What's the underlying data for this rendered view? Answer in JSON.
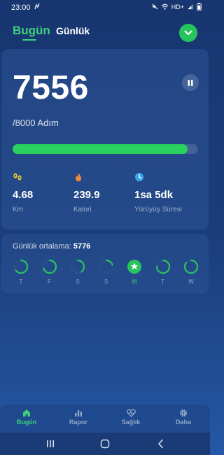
{
  "status_bar": {
    "time": "23:00",
    "network": "HD+"
  },
  "header": {
    "tabs": [
      {
        "label": "Bugün",
        "active": true
      },
      {
        "label": "Günlük",
        "active": false
      }
    ]
  },
  "summary": {
    "steps": "7556",
    "goal": "/8000 Adım",
    "progress_fraction": 0.9445,
    "stats": [
      {
        "icon": "footprints-icon",
        "value": "4.68",
        "label": "Km"
      },
      {
        "icon": "flame-icon",
        "value": "239.9",
        "label": "Kalori"
      },
      {
        "icon": "clock-icon",
        "value": "1sa 5dk",
        "label": "Yürüyüş Süresi"
      }
    ]
  },
  "weekly": {
    "title": "Günlük ortalama:",
    "average": "5776",
    "days": [
      {
        "label": "T",
        "fraction": 0.65,
        "active": false
      },
      {
        "label": "F",
        "fraction": 0.7,
        "active": false
      },
      {
        "label": "S",
        "fraction": 0.4,
        "active": false
      },
      {
        "label": "S",
        "fraction": 0.2,
        "active": false
      },
      {
        "label": "M",
        "fraction": 1.0,
        "active": true
      },
      {
        "label": "T",
        "fraction": 0.75,
        "active": false
      },
      {
        "label": "W",
        "fraction": 0.85,
        "active": false
      }
    ]
  },
  "bottom_nav": {
    "items": [
      {
        "label": "Bugün",
        "icon": "home-icon",
        "active": true
      },
      {
        "label": "Rapor",
        "icon": "bar-chart-icon",
        "active": false
      },
      {
        "label": "Sağlık",
        "icon": "heart-pulse-icon",
        "active": false
      },
      {
        "label": "Daha",
        "icon": "gear-icon",
        "active": false
      }
    ]
  },
  "colors": {
    "accent": "#3fd17a",
    "progress": "#29d25e",
    "ring": "#29c45e",
    "ring_track": "#2c4f8a",
    "background_top": "#17356f",
    "background_bottom": "#2458a6"
  }
}
